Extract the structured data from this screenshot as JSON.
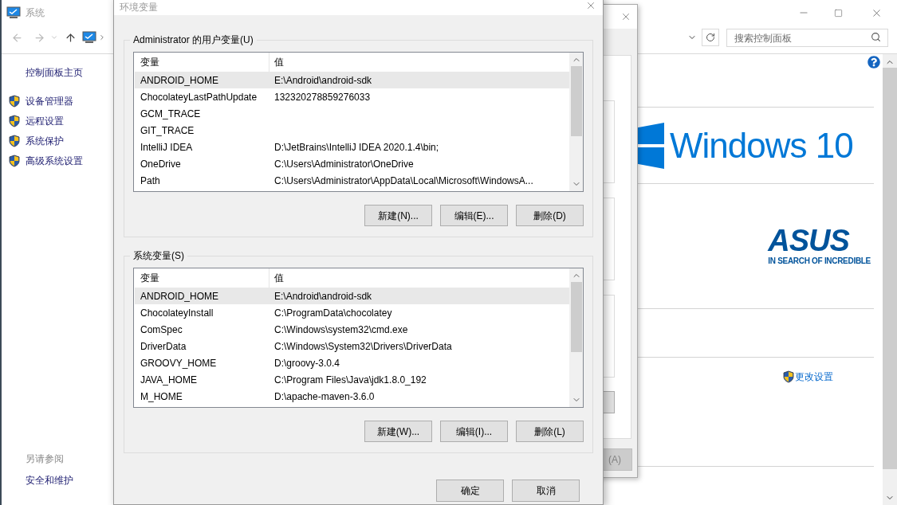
{
  "control_panel": {
    "title": "系统",
    "search": {
      "placeholder": "搜索控制面板"
    },
    "sidebar": {
      "home_link": "控制面板主页",
      "tasks": [
        "设备管理器",
        "远程设置",
        "系统保护",
        "高级系统设置"
      ],
      "see_also": {
        "heading": "另请参阅",
        "links": [
          "安全和维护"
        ]
      }
    },
    "edition_logo": "Windows 10",
    "manufacturer_logo": {
      "name": "ASUS",
      "tagline": "IN SEARCH OF INCREDIBLE"
    },
    "change_settings_link": "更改设置"
  },
  "system_properties": {
    "apply_button": "(A)"
  },
  "environment_variables": {
    "title": "环境变量",
    "user_variables": {
      "label": "Administrator 的用户变量(U)",
      "columns": [
        "变量",
        "值"
      ],
      "rows": [
        {
          "name": "ANDROID_HOME",
          "value": "E:\\Android\\android-sdk",
          "selected": true
        },
        {
          "name": "ChocolateyLastPathUpdate",
          "value": "132320278859276033",
          "selected": false
        },
        {
          "name": "GCM_TRACE",
          "selected": false
        },
        {
          "name": "GIT_TRACE",
          "selected": false
        },
        {
          "name": "IntelliJ IDEA",
          "value": "D:\\JetBrains\\IntelliJ IDEA 2020.1.4\\bin;",
          "selected": false
        },
        {
          "name": "OneDrive",
          "value": "C:\\Users\\Administrator\\OneDrive",
          "selected": false
        },
        {
          "name": "Path",
          "value": "C:\\Users\\Administrator\\AppData\\Local\\Microsoft\\WindowsA...",
          "selected": false
        }
      ],
      "buttons": [
        "新建(N)...",
        "编辑(E)...",
        "删除(D)"
      ]
    },
    "system_variables": {
      "label": "系统变量(S)",
      "columns": [
        "变量",
        "值"
      ],
      "rows": [
        {
          "name": "ANDROID_HOME",
          "value": "E:\\Android\\android-sdk",
          "selected": true
        },
        {
          "name": "ChocolateyInstall",
          "value": "C:\\ProgramData\\chocolatey",
          "selected": false
        },
        {
          "name": "ComSpec",
          "value": "C:\\Windows\\system32\\cmd.exe",
          "selected": false
        },
        {
          "name": "DriverData",
          "value": "C:\\Windows\\System32\\Drivers\\DriverData",
          "selected": false
        },
        {
          "name": "GROOVY_HOME",
          "value": "D:\\groovy-3.0.4",
          "selected": false
        },
        {
          "name": "JAVA_HOME",
          "value": "C:\\Program Files\\Java\\jdk1.8.0_192",
          "selected": false
        },
        {
          "name": "M_HOME",
          "value": "D:\\apache-maven-3.6.0",
          "selected": false
        }
      ],
      "buttons": [
        "新建(W)...",
        "编辑(I)...",
        "删除(L)"
      ]
    },
    "buttons": [
      "确定",
      "取消"
    ]
  }
}
